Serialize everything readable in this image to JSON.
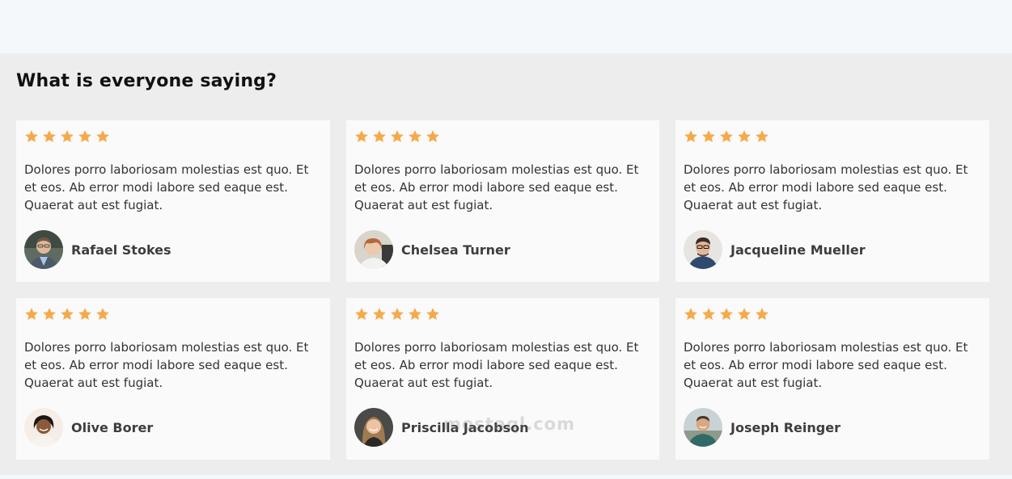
{
  "section": {
    "title": "What is everyone saying?"
  },
  "colors": {
    "star": "#f7a94a",
    "card_bg": "#fafafa",
    "section_bg": "#ededed"
  },
  "testimonials": [
    {
      "rating": 5,
      "quote": "Dolores porro laboriosam molestias est quo. Et et eos. Ab error modi labore sed eaque est. Quaerat aut est fugiat.",
      "name": "Rafael Stokes",
      "avatar_icon": "avatar-man-suit"
    },
    {
      "rating": 5,
      "quote": "Dolores porro laboriosam molestias est quo. Et et eos. Ab error modi labore sed eaque est. Quaerat aut est fugiat.",
      "name": "Chelsea Turner",
      "avatar_icon": "avatar-woman-short-hair"
    },
    {
      "rating": 5,
      "quote": "Dolores porro laboriosam molestias est quo. Et et eos. Ab error modi labore sed eaque est. Quaerat aut est fugiat.",
      "name": "Jacqueline Mueller",
      "avatar_icon": "avatar-man-glasses"
    },
    {
      "rating": 5,
      "quote": "Dolores porro laboriosam molestias est quo. Et et eos. Ab error modi labore sed eaque est. Quaerat aut est fugiat.",
      "name": "Olive Borer",
      "avatar_icon": "avatar-woman-smiling"
    },
    {
      "rating": 5,
      "quote": "Dolores porro laboriosam molestias est quo. Et et eos. Ab error modi labore sed eaque est. Quaerat aut est fugiat.",
      "name": "Priscilla Jacobson",
      "avatar_icon": "avatar-woman-long-hair"
    },
    {
      "rating": 5,
      "quote": "Dolores porro laboriosam molestias est quo. Et et eos. Ab error modi labore sed eaque est. Quaerat aut est fugiat.",
      "name": "Joseph Reinger",
      "avatar_icon": "avatar-man-outdoor"
    }
  ],
  "watermark": "mostaql.com"
}
